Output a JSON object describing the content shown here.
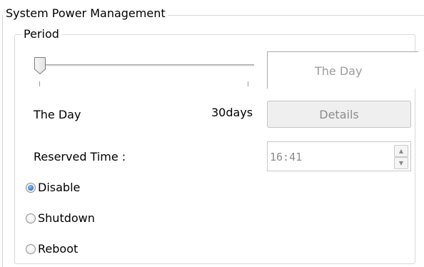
{
  "group": {
    "title": "System Power Management"
  },
  "period": {
    "title": "Period",
    "slider_position": 0,
    "value_display": "The Day",
    "min_label": "The Day",
    "max_label": "30days"
  },
  "details_button": {
    "label": "Details",
    "enabled": false
  },
  "reserved_time": {
    "label": "Reserved Time :",
    "value": "16:41",
    "enabled": false
  },
  "options": [
    {
      "label": "Disable",
      "selected": true
    },
    {
      "label": "Shutdown",
      "selected": false
    },
    {
      "label": "Reboot",
      "selected": false
    }
  ],
  "colors": {
    "radio_selected": "#2a76c6",
    "disabled_text": "#8c8c8c"
  }
}
